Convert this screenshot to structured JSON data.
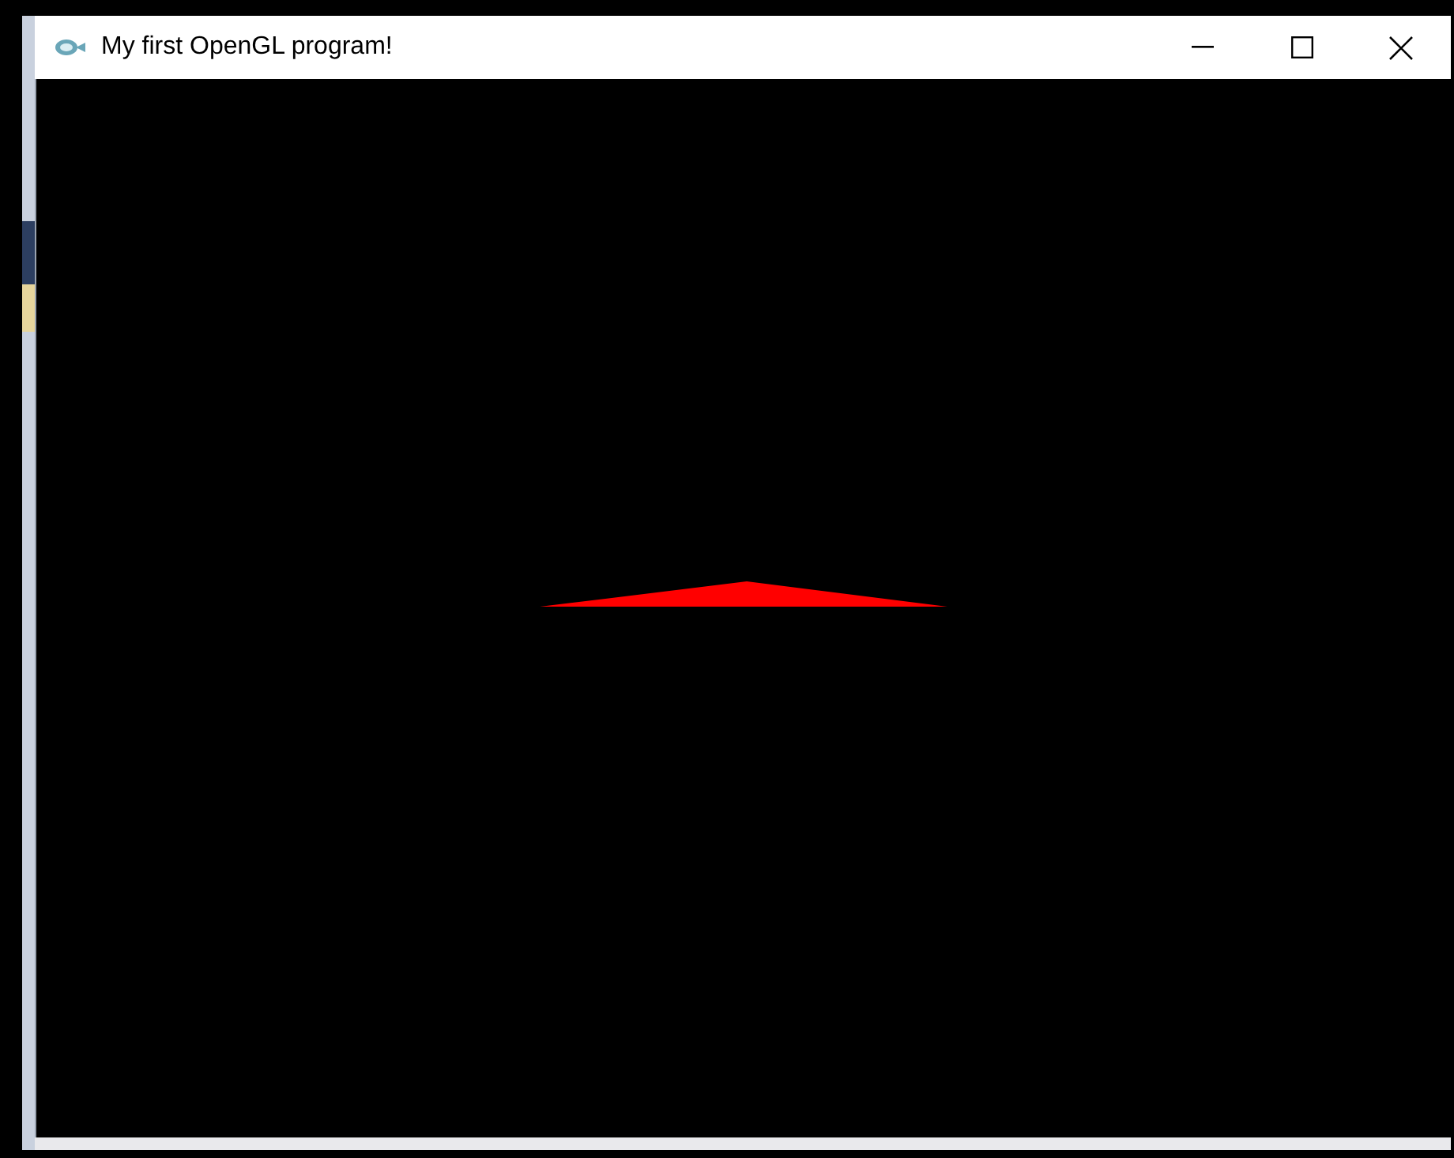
{
  "window": {
    "title": "My first OpenGL program!"
  },
  "buttons": [
    {
      "kind": "minimize"
    },
    {
      "kind": "maximize"
    },
    {
      "kind": "close"
    }
  ]
}
